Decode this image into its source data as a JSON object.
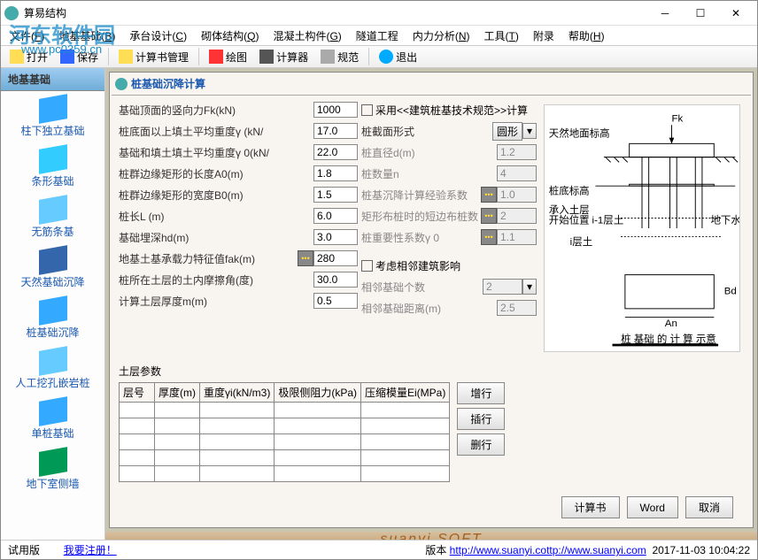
{
  "window": {
    "title": "算易结构"
  },
  "watermark": {
    "text": "河东软件园",
    "url": "www.pc0359.cn"
  },
  "menu": [
    {
      "label": "文件",
      "key": "F"
    },
    {
      "label": "地基基础",
      "key": "B"
    },
    {
      "label": "承台设计",
      "key": "C"
    },
    {
      "label": "砌体结构",
      "key": "Q"
    },
    {
      "label": "混凝土构件",
      "key": "G"
    },
    {
      "label": "隧道工程",
      "key": ""
    },
    {
      "label": "内力分析",
      "key": "N"
    },
    {
      "label": "工具",
      "key": "T"
    },
    {
      "label": "附录",
      "key": ""
    },
    {
      "label": "帮助",
      "key": "H"
    }
  ],
  "toolbar": {
    "open": "打开",
    "save": "保存",
    "manage": "计算书管理",
    "draw": "绘图",
    "calc": "计算器",
    "spec": "规范",
    "exit": "退出"
  },
  "sidebar": {
    "tab": "地基基础",
    "items": [
      {
        "label": "柱下独立基础",
        "icon": "cube-icon"
      },
      {
        "label": "条形基础",
        "icon": "stack-icon"
      },
      {
        "label": "无筋条基",
        "icon": "bar-icon"
      },
      {
        "label": "天然基础沉降",
        "icon": "doc-icon"
      },
      {
        "label": "桩基础沉降",
        "icon": "disc-icon"
      },
      {
        "label": "人工挖孔嵌岩桩",
        "icon": "cube2-icon"
      },
      {
        "label": "单桩基础",
        "icon": "cube3-icon"
      },
      {
        "label": "地下室侧墙",
        "icon": "tag-icon"
      }
    ]
  },
  "panel": {
    "title": "桩基础沉降计算",
    "left_fields": [
      {
        "label": "基础顶面的竖向力Fk(kN)",
        "value": "1000"
      },
      {
        "label": "桩底面以上填土平均重度γ (kN/",
        "value": "17.0"
      },
      {
        "label": "基础和填土填土平均重度γ 0(kN/",
        "value": "22.0"
      },
      {
        "label": "桩群边缘矩形的长度A0(m)",
        "value": "1.8"
      },
      {
        "label": "桩群边缘矩形的宽度B0(m)",
        "value": "1.5"
      },
      {
        "label": "桩长L (m)",
        "value": "6.0"
      },
      {
        "label": "基础埋深hd(m)",
        "value": "3.0"
      },
      {
        "label": "地基土基承载力特征值fak(m)",
        "value": "280"
      },
      {
        "label": "桩所在土层的土内摩擦角(度)",
        "value": "30.0"
      },
      {
        "label": "计算土层厚度m(m)",
        "value": "0.5"
      }
    ],
    "check1": "采用<<建筑桩基技术规范>>计算",
    "mid_fields": [
      {
        "label": "桩截面形式",
        "value": "圆形",
        "type": "select"
      },
      {
        "label": "桩直径d(m)",
        "value": "1.2",
        "disabled": true
      },
      {
        "label": "桩数量n",
        "value": "4",
        "disabled": true
      },
      {
        "label": "桩基沉降计算经验系数",
        "value": "1.0",
        "dd": true,
        "disabled": true
      },
      {
        "label": "矩形布桩时的短边布桩数",
        "value": "2",
        "dd": true,
        "disabled": true
      },
      {
        "label": "桩重要性系数γ 0",
        "value": "1.1",
        "dd": true,
        "disabled": true
      }
    ],
    "check2": "考虑相邻建筑影响",
    "mid_fields2": [
      {
        "label": "相邻基础个数",
        "value": "2",
        "disabled": true
      },
      {
        "label": "相邻基础距离(m)",
        "value": "2.5",
        "disabled": true
      }
    ],
    "table_title": "土层参数",
    "table_headers": [
      "层号",
      "厚度(m)",
      "重度γi(kN/m3)",
      "极限侧阻力(kPa)",
      "压缩模量Ei(MPa)"
    ],
    "table_btns": {
      "add": "增行",
      "insert": "插行",
      "del": "删行"
    },
    "bottom_btns": {
      "calc": "计算书",
      "word": "Word",
      "cancel": "取消"
    },
    "diagram_caption": "桩 基础 的 计 算 示意",
    "diagram_labels": {
      "fk": "Fk",
      "ground": "天然地面标高",
      "base": "桩底标高",
      "bearing": "承入土层",
      "start": "开始位置",
      "layer_i1": "i-1层土",
      "layer_i": "i层土",
      "water": "地下水位标高",
      "an": "An",
      "bd": "Bd"
    }
  },
  "status": {
    "version": "试用版",
    "register": "我要注册！",
    "label": "版本 ",
    "url1": "http://www.suanyi.co",
    "url2": "ttp://www.suanyi.com",
    "time": "2017-11-03 10:04:22"
  },
  "banner": "suanyi.SOFT"
}
